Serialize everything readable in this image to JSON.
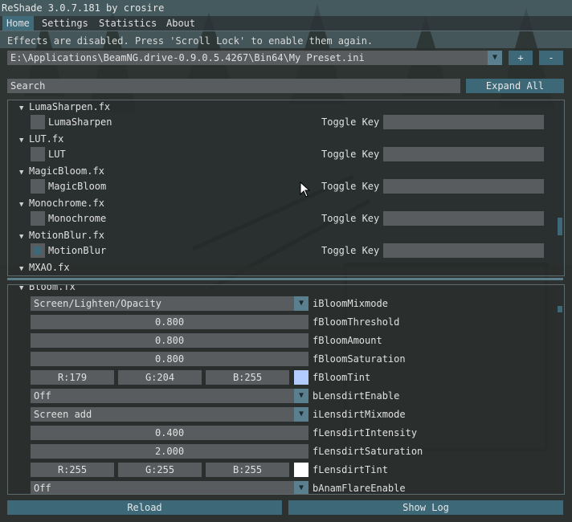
{
  "title": "ReShade 3.0.7.181 by crosire",
  "menu": [
    "Home",
    "Settings",
    "Statistics",
    "About"
  ],
  "notice": "Effects are disabled. Press 'Scroll Lock' to enable them again.",
  "preset": {
    "path": "E:\\Applications\\BeamNG.drive-0.9.0.5.4267\\Bin64\\My Preset.ini",
    "add": "+",
    "remove": "-"
  },
  "search": {
    "placeholder": "Search",
    "expand_all": "Expand All"
  },
  "effects": {
    "toggle_key_label": "Toggle Key",
    "items": [
      {
        "file": "LumaSharpen.fx",
        "name": "LumaSharpen",
        "enabled": false
      },
      {
        "file": "LUT.fx",
        "name": "LUT",
        "enabled": false
      },
      {
        "file": "MagicBloom.fx",
        "name": "MagicBloom",
        "enabled": false
      },
      {
        "file": "Monochrome.fx",
        "name": "Monochrome",
        "enabled": false
      },
      {
        "file": "MotionBlur.fx",
        "name": "MotionBlur",
        "enabled": true
      },
      {
        "file": "MXAO.fx"
      }
    ]
  },
  "params": {
    "section": "Bloom.fx",
    "rows": [
      {
        "type": "combo",
        "value": "Screen/Lighten/Opacity",
        "name": "iBloomMixmode"
      },
      {
        "type": "slider",
        "value": "0.800",
        "name": "fBloomThreshold"
      },
      {
        "type": "slider",
        "value": "0.800",
        "name": "fBloomAmount"
      },
      {
        "type": "slider",
        "value": "0.800",
        "name": "fBloomSaturation"
      },
      {
        "type": "color",
        "r": "R:179",
        "g": "G:204",
        "b": "B:255",
        "swatch": "#b3ccff",
        "name": "fBloomTint"
      },
      {
        "type": "combo",
        "value": "Off",
        "name": "bLensdirtEnable"
      },
      {
        "type": "combo",
        "value": "Screen add",
        "name": "iLensdirtMixmode"
      },
      {
        "type": "slider",
        "value": "0.400",
        "name": "fLensdirtIntensity"
      },
      {
        "type": "slider",
        "value": "2.000",
        "name": "fLensdirtSaturation"
      },
      {
        "type": "color",
        "r": "R:255",
        "g": "G:255",
        "b": "B:255",
        "swatch": "#ffffff",
        "name": "fLensdirtTint"
      },
      {
        "type": "combo",
        "value": "Off",
        "name": "bAnamFlareEnable"
      }
    ]
  },
  "footer": {
    "reload": "Reload",
    "show_log": "Show Log"
  },
  "colors": {
    "accent": "#3d6878",
    "field": "#585c5e"
  }
}
